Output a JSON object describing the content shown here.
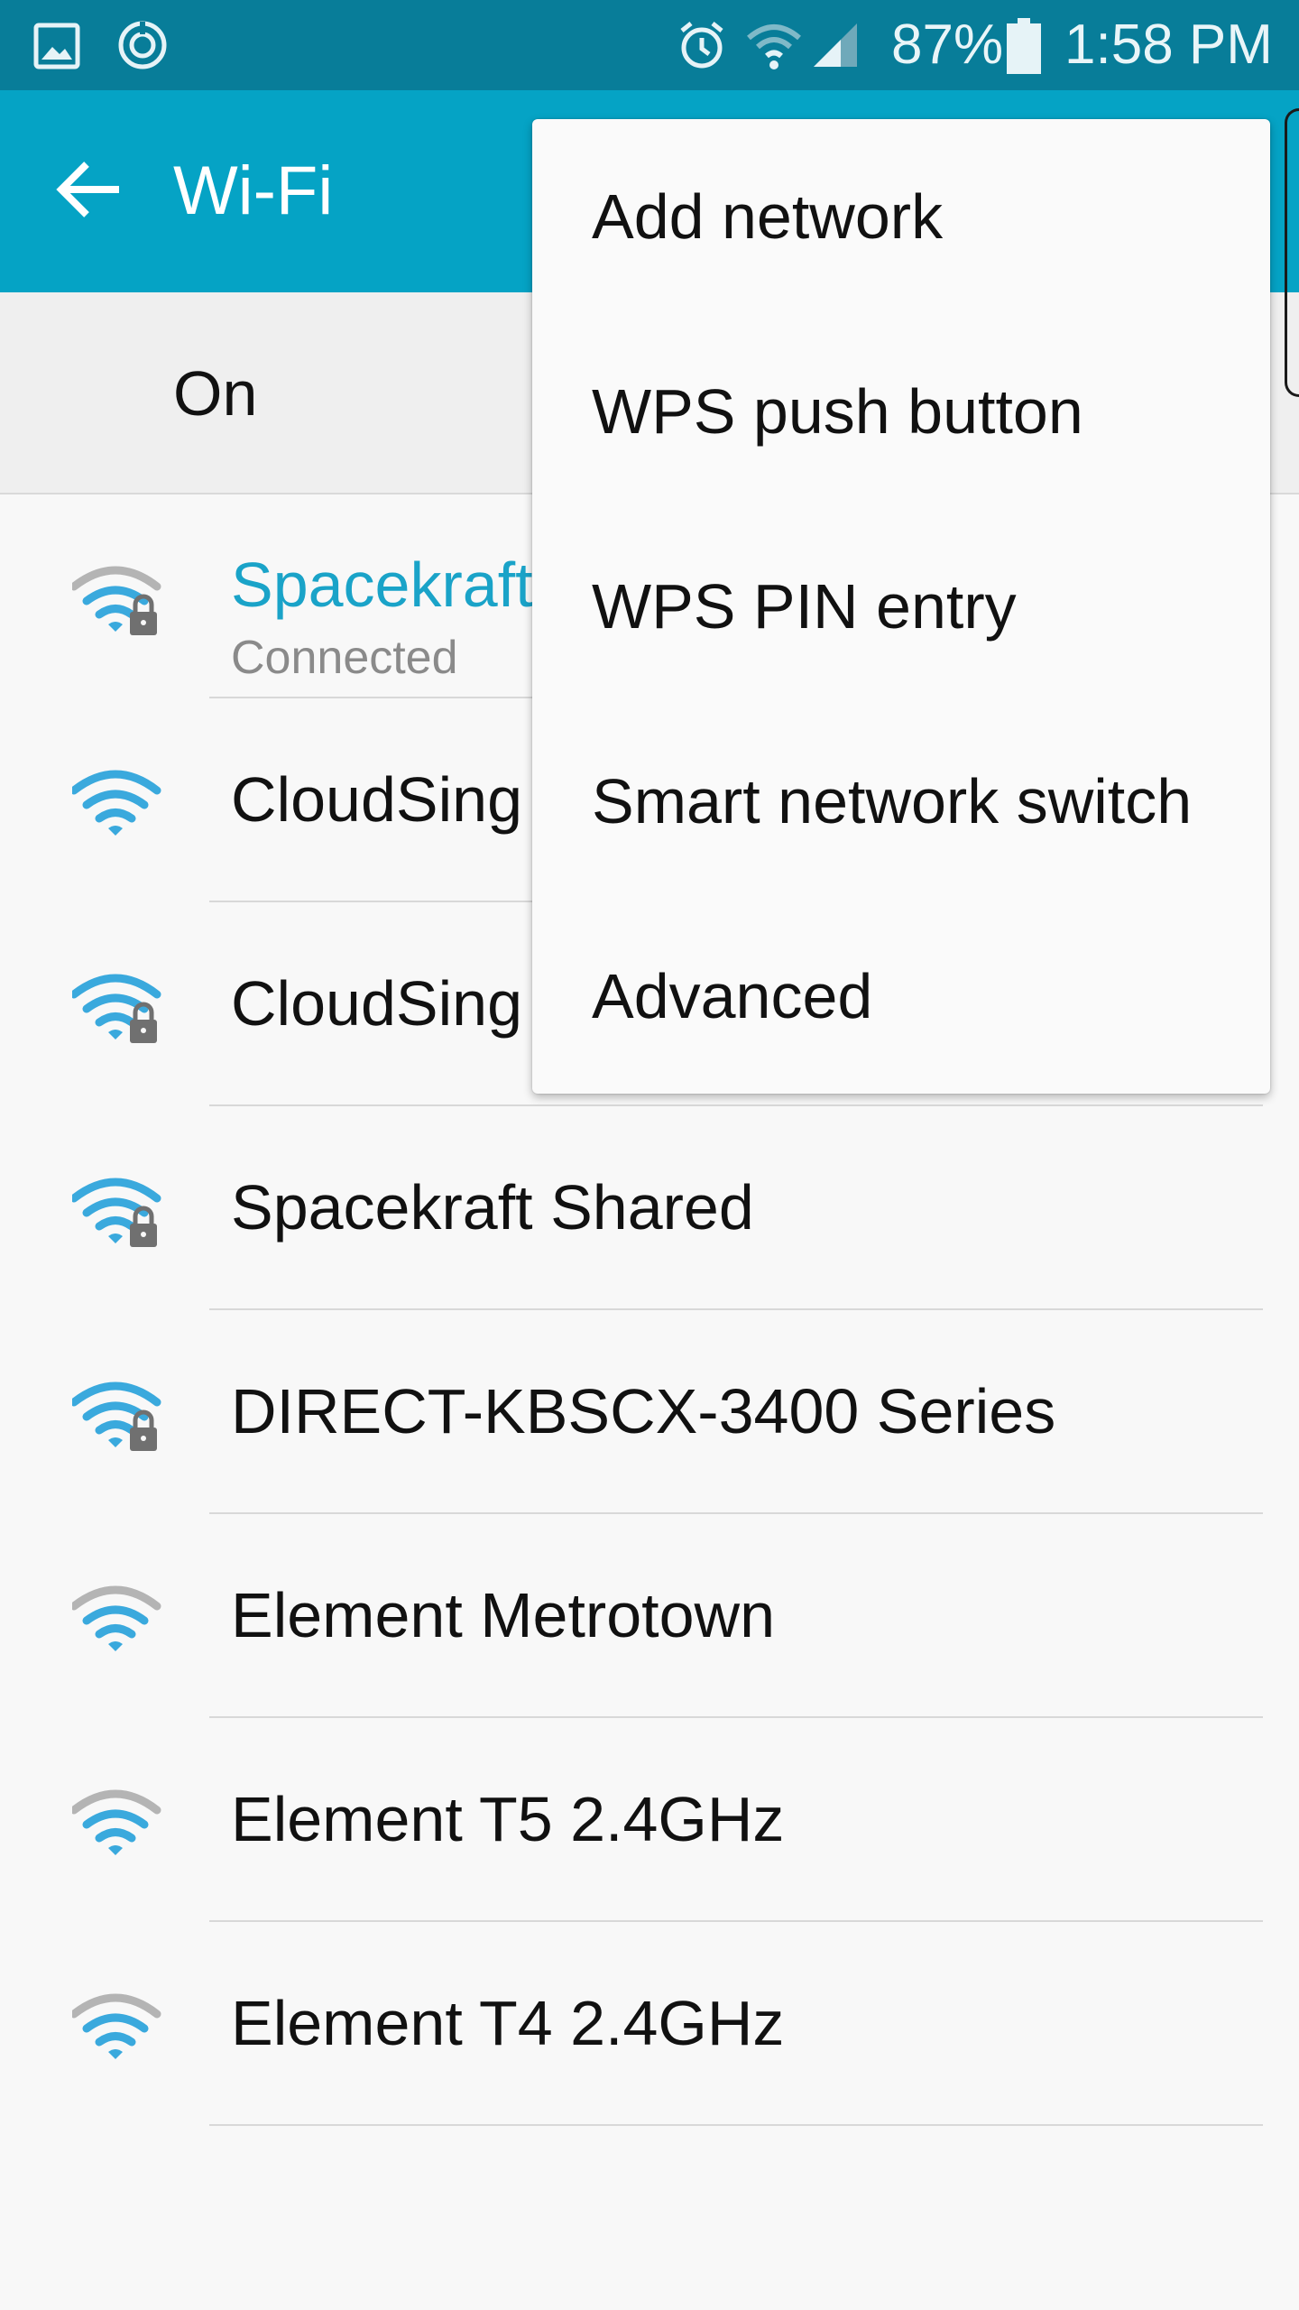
{
  "status_bar": {
    "battery_percent": "87%",
    "time": "1:58 PM",
    "icons": [
      "gallery-icon",
      "sync-icon",
      "alarm-icon",
      "wifi-signal-icon",
      "cellular-signal-icon",
      "battery-icon"
    ]
  },
  "app_bar": {
    "title": "Wi-Fi",
    "back_icon": "arrow-left-icon"
  },
  "switch_row": {
    "label": "On"
  },
  "networks": [
    {
      "name": "Spacekraft",
      "status": "Connected",
      "secured": true,
      "signal": "medium",
      "connected": true
    },
    {
      "name": "CloudSing",
      "status": "",
      "secured": false,
      "signal": "full",
      "connected": false
    },
    {
      "name": "CloudSing",
      "status": "",
      "secured": true,
      "signal": "full",
      "connected": false
    },
    {
      "name": "Spacekraft Shared",
      "status": "",
      "secured": true,
      "signal": "full",
      "connected": false
    },
    {
      "name": "DIRECT-KBSCX-3400 Series",
      "status": "",
      "secured": true,
      "signal": "full",
      "connected": false
    },
    {
      "name": "Element Metrotown",
      "status": "",
      "secured": false,
      "signal": "medium",
      "connected": false
    },
    {
      "name": "Element T5 2.4GHz",
      "status": "",
      "secured": false,
      "signal": "medium",
      "connected": false
    },
    {
      "name": "Element T4 2.4GHz",
      "status": "",
      "secured": false,
      "signal": "medium",
      "connected": false
    }
  ],
  "menu": {
    "items": [
      {
        "label": "Add network"
      },
      {
        "label": "WPS push button"
      },
      {
        "label": "WPS PIN entry"
      },
      {
        "label": "Smart network switch"
      },
      {
        "label": "Advanced"
      }
    ]
  },
  "colors": {
    "status_bar": "#087d99",
    "app_bar": "#05a3c5",
    "wifi_active": "#3aa9dd",
    "wifi_inactive": "#b4b4b4",
    "connected_text": "#1aa3c8"
  }
}
